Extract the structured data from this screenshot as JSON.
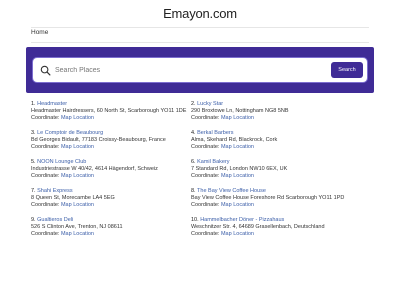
{
  "header": {
    "logo": "Emayon.com"
  },
  "breadcrumb": {
    "home": "Home"
  },
  "search": {
    "placeholder": "Search Places",
    "button_label": "Search"
  },
  "places": [
    {
      "index": "1.",
      "name": "Headmaster",
      "address": "Headmaster Hairdressers, 60 North St, Scarborough YO11 1DE",
      "coord_label": "Coordinate:",
      "map_link": "Map Location"
    },
    {
      "index": "2.",
      "name": "Lucky Star",
      "address": "290 Broxtowe Ln, Nottingham NG8 5NB",
      "coord_label": "Coordinate:",
      "map_link": "Map Location"
    },
    {
      "index": "3.",
      "name": "Le Comptoir de Beaubourg",
      "address": "Bd Georges Bidault, 77183 Croissy-Beaubourg, France",
      "coord_label": "Coordinate:",
      "map_link": "Map Location"
    },
    {
      "index": "4.",
      "name": "Berkal Barbers",
      "address": "Alma, Skehard Rd, Blackrock, Cork",
      "coord_label": "Coordinate:",
      "map_link": "Map Location"
    },
    {
      "index": "5.",
      "name": "NOON Lounge Club",
      "address": "Industriestrasse W 40/42, 4614 Hägendorf, Schweiz",
      "coord_label": "Coordinate:",
      "map_link": "Map Location"
    },
    {
      "index": "6.",
      "name": "Kamil Bakery",
      "address": "7 Standard Rd, London NW10 6EX, UK",
      "coord_label": "Coordinate:",
      "map_link": "Map Location"
    },
    {
      "index": "7.",
      "name": "Shahi Express",
      "address": "8 Queen St, Morecambe LA4 5EG",
      "coord_label": "Coordinate:",
      "map_link": "Map Location"
    },
    {
      "index": "8.",
      "name": "The Bay View Coffee House",
      "address": "Bay View Coffee House Foreshore Rd Scarborough YO11 1PD",
      "coord_label": "Coordinate:",
      "map_link": "Map Location"
    },
    {
      "index": "9.",
      "name": "Gualtieros Deli",
      "address": "526 S Clinton Ave, Trenton, NJ 08611",
      "coord_label": "Coordinate:",
      "map_link": "Map Location"
    },
    {
      "index": "10.",
      "name": "Hammelbacher Döner - Pizzahaus",
      "address": "Weschnitzer Str. 4, 64689 Grasellenbach, Deutschland",
      "coord_label": "Coordinate:",
      "map_link": "Map Location"
    }
  ]
}
